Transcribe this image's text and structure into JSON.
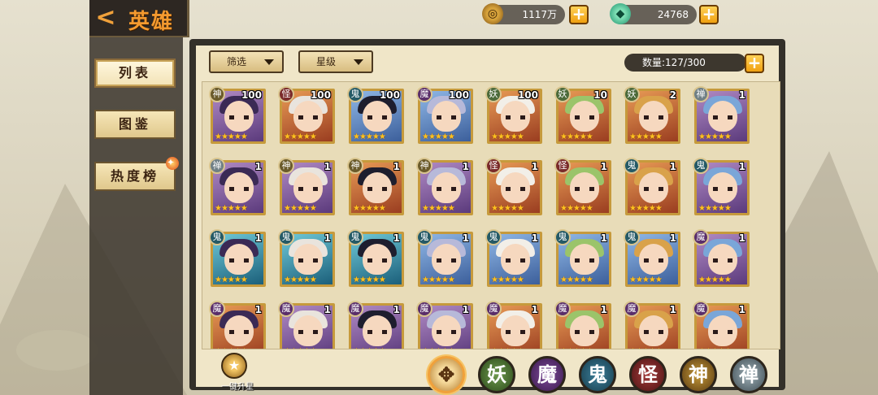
{
  "header": {
    "title": "英雄",
    "coins": "1117万",
    "jade": "24768"
  },
  "sidebar": {
    "items": [
      {
        "label": "列表"
      },
      {
        "label": "图鉴"
      },
      {
        "label": "热度榜"
      }
    ]
  },
  "filters": {
    "filter_label": "筛选",
    "star_label": "星级",
    "count": "数量:127/300"
  },
  "heroes": [
    {
      "faction": "神",
      "level": "100",
      "stars": "★★★★★",
      "color": "purple"
    },
    {
      "faction": "怪",
      "level": "100",
      "stars": "★★★★★",
      "color": "orange"
    },
    {
      "faction": "鬼",
      "level": "100",
      "stars": "★★★★★",
      "color": "blue"
    },
    {
      "faction": "魔",
      "level": "100",
      "stars": "★★★★★",
      "color": "blue"
    },
    {
      "faction": "妖",
      "level": "100",
      "stars": "★★★★★",
      "color": "orange"
    },
    {
      "faction": "妖",
      "level": "10",
      "stars": "★★★★★",
      "color": "orange"
    },
    {
      "faction": "妖",
      "level": "2",
      "stars": "★★★★★",
      "color": "orange"
    },
    {
      "faction": "禅",
      "level": "1",
      "stars": "★★★★★",
      "color": "purple"
    },
    {
      "faction": "禅",
      "level": "1",
      "stars": "★★★★★",
      "color": "purple"
    },
    {
      "faction": "神",
      "level": "1",
      "stars": "★★★★★",
      "color": "purple"
    },
    {
      "faction": "神",
      "level": "1",
      "stars": "★★★★★",
      "color": "orange"
    },
    {
      "faction": "神",
      "level": "1",
      "stars": "★★★★★",
      "color": "purple"
    },
    {
      "faction": "怪",
      "level": "1",
      "stars": "★★★★★",
      "color": "orange"
    },
    {
      "faction": "怪",
      "level": "1",
      "stars": "★★★★★",
      "color": "orange"
    },
    {
      "faction": "鬼",
      "level": "1",
      "stars": "★★★★★",
      "color": "orange"
    },
    {
      "faction": "鬼",
      "level": "1",
      "stars": "★★★★★",
      "color": "purple"
    },
    {
      "faction": "鬼",
      "level": "1",
      "stars": "★★★★★",
      "color": "teal"
    },
    {
      "faction": "鬼",
      "level": "1",
      "stars": "★★★★★",
      "color": "teal"
    },
    {
      "faction": "鬼",
      "level": "1",
      "stars": "★★★★★",
      "color": "teal"
    },
    {
      "faction": "鬼",
      "level": "1",
      "stars": "★★★★★",
      "color": "blue"
    },
    {
      "faction": "鬼",
      "level": "1",
      "stars": "★★★★★",
      "color": "blue"
    },
    {
      "faction": "鬼",
      "level": "1",
      "stars": "★★★★★",
      "color": "blue"
    },
    {
      "faction": "鬼",
      "level": "1",
      "stars": "★★★★★",
      "color": "blue"
    },
    {
      "faction": "魔",
      "level": "1",
      "stars": "★★★★★",
      "color": "purple"
    },
    {
      "faction": "魔",
      "level": "1",
      "stars": "★★★★★",
      "color": "orange"
    },
    {
      "faction": "魔",
      "level": "1",
      "stars": "★★★★★",
      "color": "purple"
    },
    {
      "faction": "魔",
      "level": "1",
      "stars": "★★★★★",
      "color": "purple"
    },
    {
      "faction": "魔",
      "level": "1",
      "stars": "★★★★★",
      "color": "purple"
    },
    {
      "faction": "魔",
      "level": "1",
      "stars": "★★★★★",
      "color": "orange"
    },
    {
      "faction": "魔",
      "level": "1",
      "stars": "★★★★★",
      "color": "orange"
    },
    {
      "faction": "魔",
      "level": "1",
      "stars": "★★★★★",
      "color": "orange"
    },
    {
      "faction": "魔",
      "level": "1",
      "stars": "★★★★★",
      "color": "orange"
    }
  ],
  "bottom": {
    "upstar_label": "一键升星",
    "tabs": [
      {
        "key": "all",
        "label": ""
      },
      {
        "key": "yao",
        "label": "妖"
      },
      {
        "key": "mo",
        "label": "魔"
      },
      {
        "key": "gui",
        "label": "鬼"
      },
      {
        "key": "guai",
        "label": "怪"
      },
      {
        "key": "shen",
        "label": "神"
      },
      {
        "key": "chan",
        "label": "禅"
      }
    ]
  }
}
